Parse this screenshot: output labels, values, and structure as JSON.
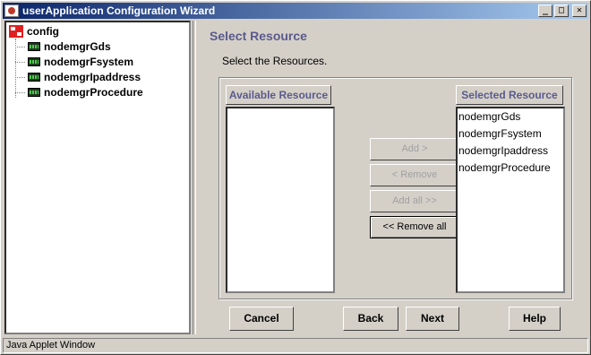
{
  "window": {
    "title": "userApplication Configuration Wizard",
    "controls": {
      "minimize": "_",
      "maximize": "□",
      "close": "✕"
    }
  },
  "tree": {
    "root": {
      "label": "config",
      "icon": "config-icon"
    },
    "items": [
      {
        "label": "nodemgrGds",
        "icon": "resource-icon"
      },
      {
        "label": "nodemgrFsystem",
        "icon": "resource-icon"
      },
      {
        "label": "nodemgrIpaddress",
        "icon": "resource-icon"
      },
      {
        "label": "nodemgrProcedure",
        "icon": "resource-icon"
      }
    ]
  },
  "main": {
    "heading": "Select Resource",
    "instruction": "Select the Resources.",
    "available": {
      "header": "Available Resource",
      "items": []
    },
    "selected": {
      "header": "Selected Resource",
      "items": [
        "nodemgrGds",
        "nodemgrFsystem",
        "nodemgrIpaddress",
        "nodemgrProcedure"
      ]
    },
    "buttons": {
      "add": "Add >",
      "remove": "< Remove",
      "add_all": "Add all >>",
      "remove_all": "<< Remove all"
    }
  },
  "footer": {
    "cancel": "Cancel",
    "back": "Back",
    "next": "Next",
    "help": "Help"
  },
  "status": {
    "text": "Java Applet Window"
  },
  "colors": {
    "title_start": "#0a246a",
    "title_end": "#a6caf0",
    "heading": "#5a5a8c",
    "face": "#d4d0c8"
  }
}
